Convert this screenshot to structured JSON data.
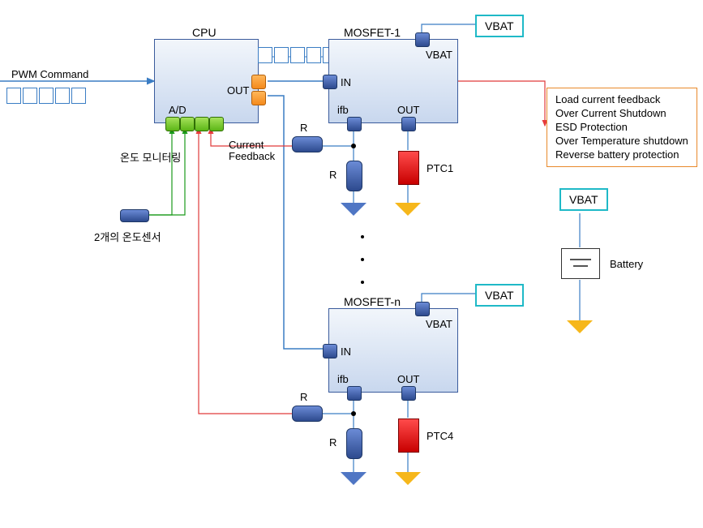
{
  "diagram": {
    "cpu": {
      "title": "CPU",
      "out": "OUT",
      "ad": "A/D"
    },
    "pwm": {
      "label": "PWM Command"
    },
    "temp": {
      "monitor": "온도 모니터링",
      "sensor": "2개의 온도센서"
    },
    "mosfet1": {
      "title": "MOSFET-1",
      "vbat": "VBAT",
      "in": "IN",
      "ifb": "ifb",
      "out": "OUT"
    },
    "mosfetN": {
      "title": "MOSFET-n",
      "vbat": "VBAT",
      "in": "IN",
      "ifb": "ifb",
      "out": "OUT"
    },
    "currentFeedback": "Current\nFeedback",
    "r": "R",
    "ptc1": "PTC1",
    "ptc4": "PTC4",
    "vbat": "VBAT",
    "battery": "Battery",
    "features": {
      "l1": "Load current feedback",
      "l2": "Over Current Shutdown",
      "l3": "ESD Protection",
      "l4": "Over Temperature shutdown",
      "l5": "Reverse battery protection"
    }
  }
}
